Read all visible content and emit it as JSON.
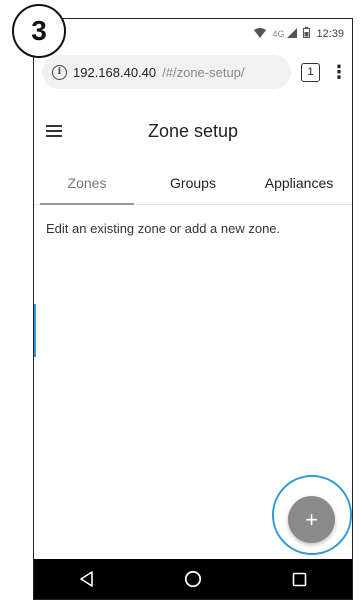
{
  "step_number": "3",
  "status_bar": {
    "network": "4G",
    "time": "12:39"
  },
  "browser": {
    "url_host": "192.168.40.40",
    "url_path": "/#/zone-setup/",
    "tab_count": "1",
    "menu_icon": "more-vert-icon"
  },
  "app": {
    "title": "Zone setup",
    "menu_icon": "hamburger-icon"
  },
  "tabs": [
    {
      "label": "Zones",
      "active": true
    },
    {
      "label": "Groups",
      "active": false
    },
    {
      "label": "Appliances",
      "active": false
    }
  ],
  "main": {
    "intro_text": "Edit an existing zone or add a new zone."
  },
  "fab": {
    "label": "+",
    "color": "#8a8a8a",
    "highlight_color": "#2f9bd6"
  },
  "nav": {
    "back_icon": "back-triangle-icon",
    "home_icon": "home-circle-icon",
    "recents_icon": "recents-square-icon"
  }
}
